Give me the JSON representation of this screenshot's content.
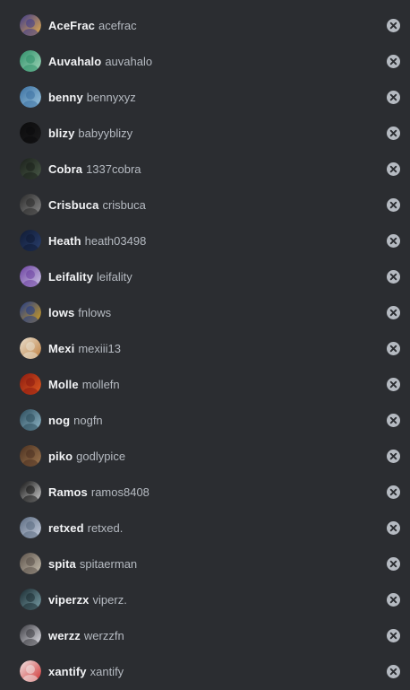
{
  "members": [
    {
      "display": "AceFrac",
      "username": "acefrac",
      "avatar_colors": [
        "#3d3a8c",
        "#e8b04a"
      ]
    },
    {
      "display": "Auvahalo",
      "username": "auvahalo",
      "avatar_colors": [
        "#2f8f6a",
        "#9fd6b8"
      ]
    },
    {
      "display": "benny",
      "username": "bennyxyz",
      "avatar_colors": [
        "#3a6fa0",
        "#9bc6e0"
      ]
    },
    {
      "display": "blizy",
      "username": "babyyblizy",
      "avatar_colors": [
        "#0b0b0c",
        "#1a1a1c"
      ]
    },
    {
      "display": "Cobra",
      "username": "1337cobra",
      "avatar_colors": [
        "#1a1f1a",
        "#4a5a48"
      ]
    },
    {
      "display": "Crisbuca",
      "username": "crisbuca",
      "avatar_colors": [
        "#2a2a2a",
        "#8a8a8a"
      ]
    },
    {
      "display": "Heath",
      "username": "heath03498",
      "avatar_colors": [
        "#0f1a33",
        "#2a3f6e"
      ]
    },
    {
      "display": "Leifality",
      "username": "leifality",
      "avatar_colors": [
        "#6b3fa0",
        "#d0c8e8"
      ]
    },
    {
      "display": "lows",
      "username": "fnlows",
      "avatar_colors": [
        "#1f3a8a",
        "#d4a020"
      ]
    },
    {
      "display": "Mexi",
      "username": "mexiii13",
      "avatar_colors": [
        "#e8e0d0",
        "#c08040"
      ]
    },
    {
      "display": "Molle",
      "username": "mollefn",
      "avatar_colors": [
        "#8a1a10",
        "#e05a20"
      ]
    },
    {
      "display": "nog",
      "username": "nogfn",
      "avatar_colors": [
        "#2a4a5a",
        "#90b8c8"
      ]
    },
    {
      "display": "piko",
      "username": "godlypice",
      "avatar_colors": [
        "#4a3020",
        "#a07850"
      ]
    },
    {
      "display": "Ramos",
      "username": "ramos8408",
      "avatar_colors": [
        "#111111",
        "#cfcfcf"
      ]
    },
    {
      "display": "retxed",
      "username": "retxed.",
      "avatar_colors": [
        "#5a6a80",
        "#c8d0e0"
      ]
    },
    {
      "display": "spita",
      "username": "spitaerman",
      "avatar_colors": [
        "#5a5048",
        "#c8c0b0"
      ]
    },
    {
      "display": "viperzx",
      "username": "viperz.",
      "avatar_colors": [
        "#1a2a30",
        "#7aa0a8"
      ]
    },
    {
      "display": "werzz",
      "username": "werzzfn",
      "avatar_colors": [
        "#3a3a40",
        "#e8e8ee"
      ]
    },
    {
      "display": "xantify",
      "username": "xantify",
      "avatar_colors": [
        "#f0e8e8",
        "#d03030"
      ]
    }
  ],
  "remove_icon": "circle-x-icon",
  "colors": {
    "background": "#2b2d31",
    "display_name": "#f2f3f5",
    "username": "#b5bac1",
    "remove_icon_bg": "#b5bac1",
    "remove_icon_x": "#2b2d31"
  }
}
